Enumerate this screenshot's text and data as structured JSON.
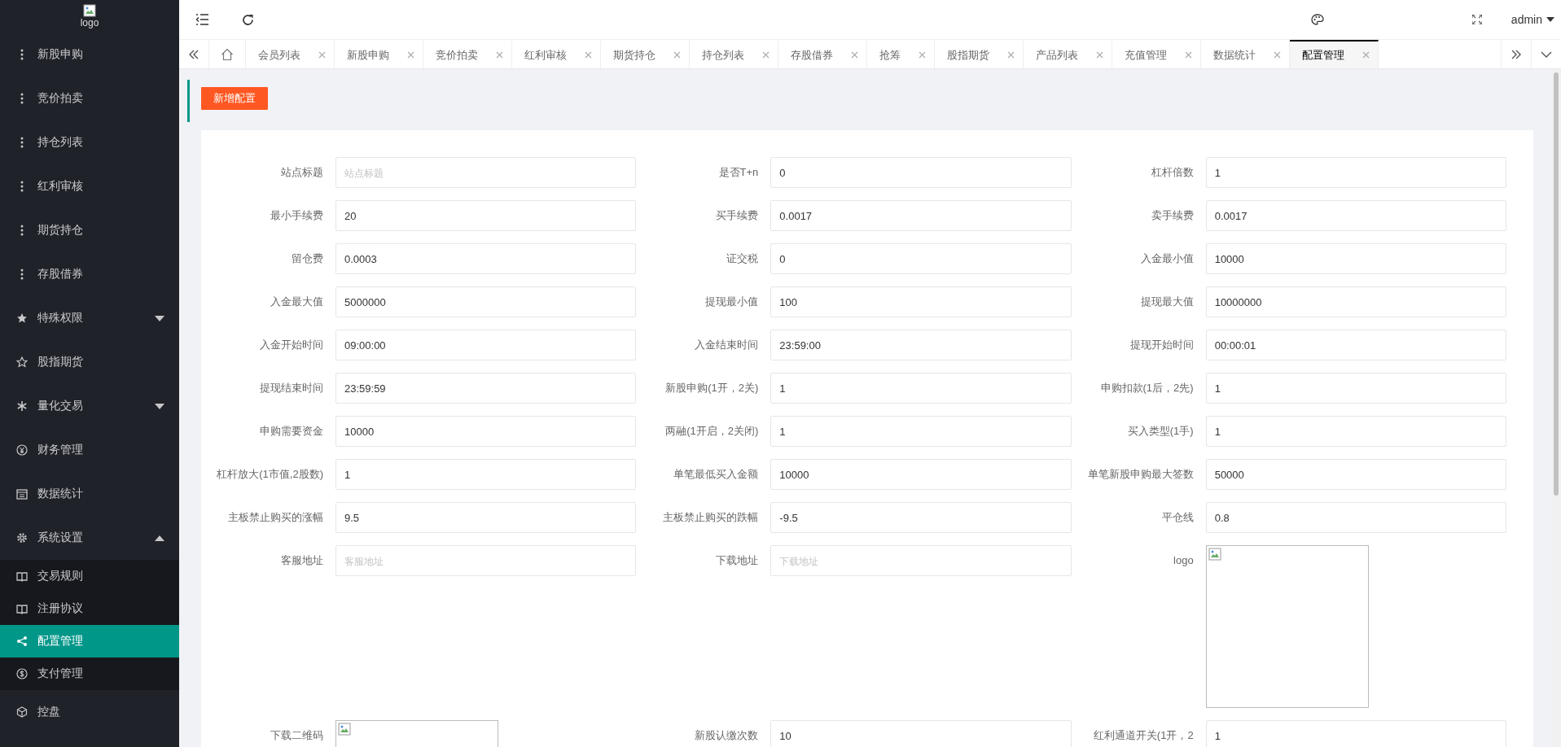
{
  "sidebar": {
    "logo_alt": "logo",
    "items": [
      {
        "label": "新股申购",
        "kind": "link",
        "selected": false
      },
      {
        "label": "竞价拍卖",
        "kind": "link",
        "selected": false
      },
      {
        "label": "持仓列表",
        "kind": "link",
        "selected": false
      },
      {
        "label": "红利审核",
        "kind": "link",
        "selected": false
      },
      {
        "label": "期货持仓",
        "kind": "link",
        "selected": false
      },
      {
        "label": "存股借券",
        "kind": "link",
        "selected": false
      },
      {
        "label": "特殊权限",
        "kind": "group",
        "expanded": false,
        "selected": false
      },
      {
        "label": "股指期货",
        "kind": "link",
        "selected": false
      },
      {
        "label": "量化交易",
        "kind": "group",
        "expanded": false,
        "selected": false
      },
      {
        "label": "财务管理",
        "kind": "link",
        "selected": false
      },
      {
        "label": "数据统计",
        "kind": "link",
        "selected": false
      },
      {
        "label": "系统设置",
        "kind": "group",
        "expanded": true,
        "selected": false,
        "children": [
          {
            "label": "交易规则",
            "selected": false
          },
          {
            "label": "注册协议",
            "selected": false
          },
          {
            "label": "配置管理",
            "selected": true
          },
          {
            "label": "支付管理",
            "selected": false
          }
        ]
      },
      {
        "label": "控盘",
        "kind": "link",
        "selected": false
      }
    ]
  },
  "header": {
    "user": "admin"
  },
  "tabs": [
    {
      "label": "会员列表",
      "selected": false
    },
    {
      "label": "新股申购",
      "selected": false
    },
    {
      "label": "竞价拍卖",
      "selected": false
    },
    {
      "label": "红利审核",
      "selected": false
    },
    {
      "label": "期货持仓",
      "selected": false
    },
    {
      "label": "持仓列表",
      "selected": false
    },
    {
      "label": "存股借券",
      "selected": false
    },
    {
      "label": "抢筹",
      "selected": false
    },
    {
      "label": "股指期货",
      "selected": false
    },
    {
      "label": "产品列表",
      "selected": false
    },
    {
      "label": "充值管理",
      "selected": false
    },
    {
      "label": "数据统计",
      "selected": false
    },
    {
      "label": "配置管理",
      "selected": true
    }
  ],
  "toolbar": {
    "add_button": "新增配置"
  },
  "form": {
    "fields": [
      {
        "label": "站点标题",
        "kind": "input",
        "placeholder": "站点标题"
      },
      {
        "label": "是否T+n",
        "kind": "input",
        "value": "0"
      },
      {
        "label": "杠杆倍数",
        "kind": "input",
        "value": "1"
      },
      {
        "label": "最小手续费",
        "kind": "input",
        "value": "20"
      },
      {
        "label": "买手续费",
        "kind": "input",
        "value": "0.0017"
      },
      {
        "label": "卖手续费",
        "kind": "input",
        "value": "0.0017"
      },
      {
        "label": "留仓费",
        "kind": "input",
        "value": "0.0003"
      },
      {
        "label": "证交税",
        "kind": "input",
        "value": "0"
      },
      {
        "label": "入金最小值",
        "kind": "input",
        "value": "10000"
      },
      {
        "label": "入金最大值",
        "kind": "input",
        "value": "5000000"
      },
      {
        "label": "提现最小值",
        "kind": "input",
        "value": "100"
      },
      {
        "label": "提现最大值",
        "kind": "input",
        "value": "10000000"
      },
      {
        "label": "入金开始时间",
        "kind": "input",
        "value": "09:00:00"
      },
      {
        "label": "入金结束时间",
        "kind": "input",
        "value": "23:59:00"
      },
      {
        "label": "提现开始时间",
        "kind": "input",
        "value": "00:00:01"
      },
      {
        "label": "提现结束时间",
        "kind": "input",
        "value": "23:59:59"
      },
      {
        "label": "新股申购(1开，2关)",
        "kind": "input",
        "value": "1"
      },
      {
        "label": "申购扣款(1后，2先)",
        "kind": "input",
        "value": "1"
      },
      {
        "label": "申购需要资金",
        "kind": "input",
        "value": "10000"
      },
      {
        "label": "两融(1开启，2关闭)",
        "kind": "input",
        "value": "1"
      },
      {
        "label": "买入类型(1手)",
        "kind": "input",
        "value": "1"
      },
      {
        "label": "杠杆放大(1市值,2股数)",
        "kind": "input",
        "value": "1"
      },
      {
        "label": "单笔最低买入金额",
        "kind": "input",
        "value": "10000"
      },
      {
        "label": "单笔新股申购最大签数",
        "kind": "input",
        "value": "50000"
      },
      {
        "label": "主板禁止购买的涨幅",
        "kind": "input",
        "value": "9.5"
      },
      {
        "label": "主板禁止购买的跌幅",
        "kind": "input",
        "value": "-9.5"
      },
      {
        "label": "平仓线",
        "kind": "input",
        "value": "0.8"
      },
      {
        "label": "客服地址",
        "kind": "input",
        "placeholder": "客服地址"
      },
      {
        "label": "下载地址",
        "kind": "input",
        "placeholder": "下载地址"
      },
      {
        "label": "logo",
        "kind": "image"
      },
      {
        "label": "下载二维码",
        "kind": "image"
      },
      {
        "label": "新股认缴次数",
        "kind": "input",
        "value": "10"
      },
      {
        "label": "红利通道开关(1开，2",
        "kind": "input",
        "value": "1"
      }
    ]
  }
}
